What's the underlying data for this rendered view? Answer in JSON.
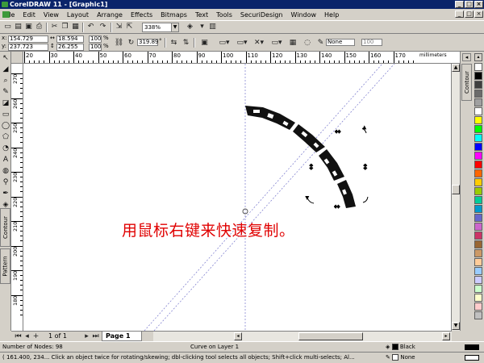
{
  "window": {
    "title": "CorelDRAW 11 - [Graphic1]"
  },
  "menu": [
    "File",
    "Edit",
    "View",
    "Layout",
    "Arrange",
    "Effects",
    "Bitmaps",
    "Text",
    "Tools",
    "SecuriDesign",
    "Window",
    "Help"
  ],
  "toolbar": {
    "zoom_value": "338%"
  },
  "propbar": {
    "x": "154.729",
    "y": "237.723",
    "width": "18.594",
    "height": "26.255",
    "scale_x": "100",
    "scale_y": "100",
    "scale_unit": "%",
    "angle": "319.89",
    "angle_unit": "°",
    "outline": "None",
    "percent": "100"
  },
  "ruler": {
    "units": "millimeters",
    "top_labels": [
      "20",
      "30",
      "40",
      "50",
      "60",
      "70",
      "80",
      "90",
      "100",
      "110",
      "120",
      "130",
      "140",
      "150",
      "160",
      "170"
    ],
    "left_labels": [
      "270",
      "260",
      "250",
      "240",
      "230",
      "220",
      "210",
      "200",
      "190",
      "180"
    ]
  },
  "canvas": {
    "annotation": "用鼠标右键来快速复制。",
    "annotation_color": "#e00000"
  },
  "dockers": {
    "right_tab": "Contour",
    "left_tabs": [
      "Contour",
      "Pattern"
    ]
  },
  "pages": {
    "count_label": "1 of 1",
    "tab_label": "Page 1"
  },
  "status": {
    "nodes": "Number of Nodes: 98",
    "object": "Curve on Layer 1",
    "fill_name": "Black",
    "outline_name": "None",
    "hint": "( 161.400, 234... Click an object twice for rotating/skewing; dbl-clicking tool selects all objects; Shift+click multi-selects; Al..."
  },
  "palette": [
    "#ffffff",
    "#000000",
    "#3f3f3f",
    "#6b6b6b",
    "#a0a0a0",
    "#ffffff",
    "#ffff00",
    "#00ff00",
    "#00ffff",
    "#0000ff",
    "#ff00ff",
    "#ff0000",
    "#ff6600",
    "#ffcc00",
    "#99cc00",
    "#00cc99",
    "#0099cc",
    "#6666cc",
    "#cc66cc",
    "#cc3366",
    "#996633",
    "#cc9966",
    "#ffcc99",
    "#99ccff",
    "#ccccff",
    "#ccffcc",
    "#ffffcc",
    "#ffcccc",
    "#c0c0c0"
  ]
}
